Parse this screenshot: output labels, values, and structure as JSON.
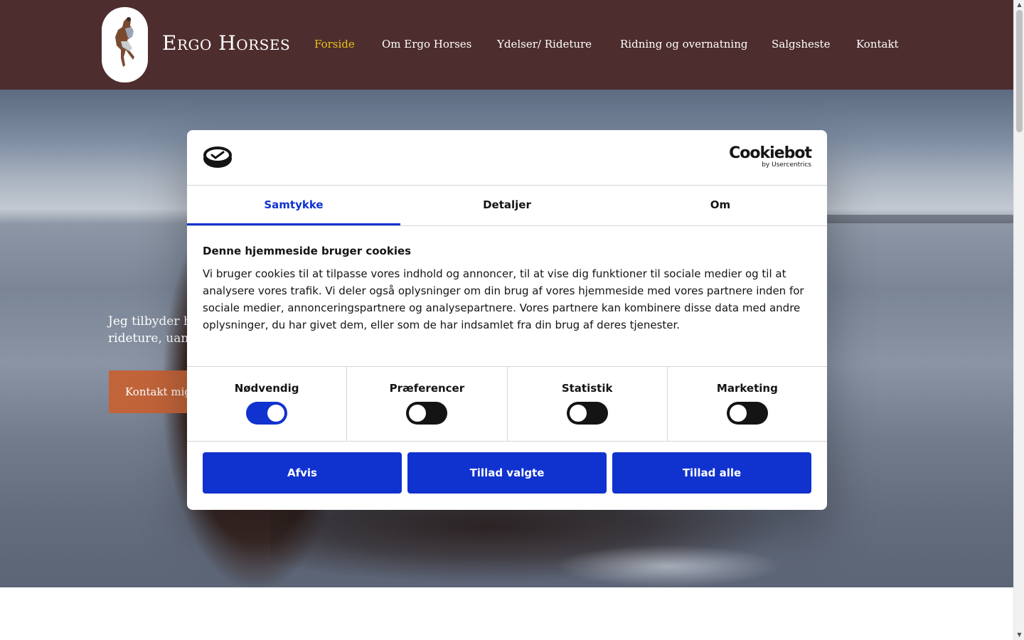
{
  "header": {
    "brand": "Ergo Horses",
    "nav": [
      {
        "label": "Forside",
        "active": true
      },
      {
        "label": "Om Ergo Horses",
        "active": false
      },
      {
        "label": "Ydelser/ Rideture",
        "active": false
      },
      {
        "label": "Ridning og overnatning",
        "active": false
      },
      {
        "label": "Salgsheste",
        "active": false
      },
      {
        "label": "Kontakt",
        "active": false
      }
    ],
    "colors": {
      "background": "#4e2d2e",
      "active_link": "#e8c21c"
    }
  },
  "hero": {
    "text_line1": "Jeg tilbyder h",
    "text_line2": "rideture, uans",
    "cta": "Kontakt mig",
    "cta_color": "#c2643a"
  },
  "cookie_dialog": {
    "brand_name": "Cookiebot",
    "brand_sub": "by Usercentrics",
    "tabs": [
      {
        "label": "Samtykke",
        "active": true
      },
      {
        "label": "Detaljer",
        "active": false
      },
      {
        "label": "Om",
        "active": false
      }
    ],
    "title": "Denne hjemmeside bruger cookies",
    "description": "Vi bruger cookies til at tilpasse vores indhold og annoncer, til at vise dig funktioner til sociale medier og til at analysere vores trafik. Vi deler også oplysninger om din brug af vores hjemmeside med vores partnere inden for sociale medier, annonceringspartnere og analysepartnere. Vores partnere kan kombinere disse data med andre oplysninger, du har givet dem, eller som de har indsamlet fra din brug af deres tjenester.",
    "categories": [
      {
        "label": "Nødvendig",
        "enabled": true
      },
      {
        "label": "Præferencer",
        "enabled": false
      },
      {
        "label": "Statistik",
        "enabled": false
      },
      {
        "label": "Marketing",
        "enabled": false
      }
    ],
    "buttons": {
      "reject": "Afvis",
      "allow_selected": "Tillad valgte",
      "allow_all": "Tillad alle"
    },
    "accent_color": "#1032cf"
  }
}
